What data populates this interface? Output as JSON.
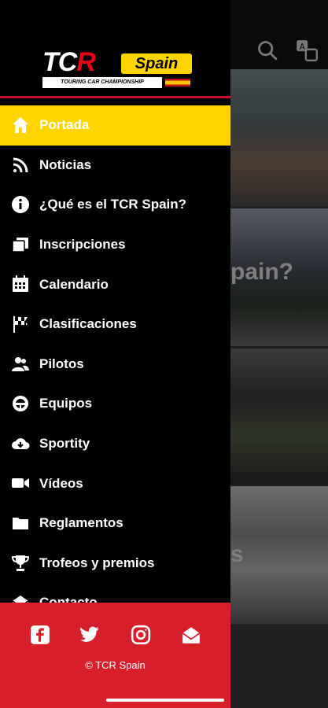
{
  "brand": {
    "tcr": "TCR",
    "spain": "Spain",
    "subtitle": "TOURING CAR CHAMPIONSHIP"
  },
  "menu": [
    {
      "label": "Portada",
      "icon": "home-icon",
      "active": true
    },
    {
      "label": "Noticias",
      "icon": "rss-icon",
      "active": false
    },
    {
      "label": "¿Qué es el TCR Spain?",
      "icon": "info-icon",
      "active": false
    },
    {
      "label": "Inscripciones",
      "icon": "copy-icon",
      "active": false
    },
    {
      "label": "Calendario",
      "icon": "calendar-icon",
      "active": false
    },
    {
      "label": "Clasificaciones",
      "icon": "checkered-flag-icon",
      "active": false
    },
    {
      "label": "Pilotos",
      "icon": "users-icon",
      "active": false
    },
    {
      "label": "Equipos",
      "icon": "steering-wheel-icon",
      "active": false
    },
    {
      "label": "Sportity",
      "icon": "cloud-download-icon",
      "active": false
    },
    {
      "label": "Vídeos",
      "icon": "video-camera-icon",
      "active": false
    },
    {
      "label": "Reglamentos",
      "icon": "folder-icon",
      "active": false
    },
    {
      "label": "Trofeos y premios",
      "icon": "trophy-icon",
      "active": false
    },
    {
      "label": "Contacto",
      "icon": "mail-open-icon",
      "active": false
    }
  ],
  "footer": {
    "copyright": "© TCR Spain",
    "social": [
      "facebook-icon",
      "twitter-icon",
      "instagram-icon",
      "mail-open-icon"
    ]
  },
  "background": {
    "card2_text": "pain?",
    "card4_text": "s"
  },
  "colors": {
    "accent_yellow": "#ffd400",
    "footer_red": "#d71f2b",
    "drawer_bg": "#000000"
  }
}
